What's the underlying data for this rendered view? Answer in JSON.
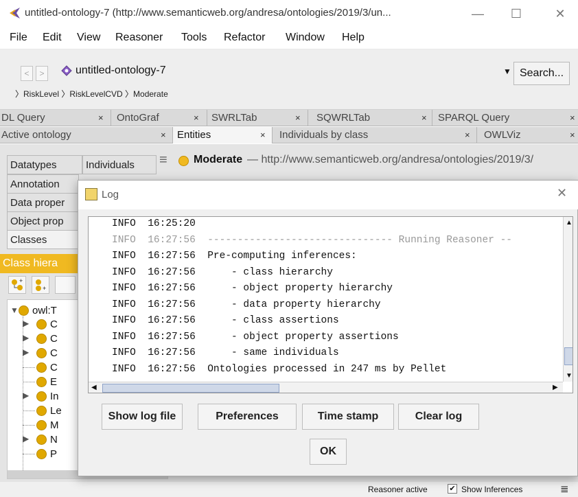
{
  "window": {
    "title": "untitled-ontology-7 (http://www.semanticweb.org/andresa/ontologies/2019/3/un...",
    "minimize": "—",
    "maximize": "☐",
    "close": "✕"
  },
  "menubar": [
    "File",
    "Edit",
    "View",
    "Reasoner",
    "Tools",
    "Refactor",
    "Window",
    "Help"
  ],
  "address": {
    "back": "<",
    "forward": ">",
    "ontology": "untitled-ontology-7",
    "search_label": "Search...",
    "breadcrumb": "〉RiskLevel 〉RiskLevelCVD 〉Moderate"
  },
  "tabs_row1": [
    {
      "label": "DL Query",
      "close": "×"
    },
    {
      "label": "OntoGraf",
      "close": "×"
    },
    {
      "label": "SWRLTab",
      "close": "×"
    },
    {
      "label": "SQWRLTab",
      "close": "×"
    },
    {
      "label": "SPARQL Query",
      "close": "×"
    }
  ],
  "tabs_row2": [
    {
      "label": "Active ontology",
      "close": "×"
    },
    {
      "label": "Entities",
      "close": "×"
    },
    {
      "label": "Individuals by class",
      "close": "×"
    },
    {
      "label": "OWLViz",
      "close": "×"
    }
  ],
  "left_tabs": {
    "datatypes": "Datatypes",
    "individuals": "Individuals",
    "annotation": "Annotation",
    "data_prop": "Data proper",
    "object_prop": "Object prop",
    "classes": "Classes",
    "class_hierarchy": "Class hiera"
  },
  "entity": {
    "menu_icon": "≡",
    "name": "Moderate",
    "iri": "— http://www.semanticweb.org/andresa/ontologies/2019/3/"
  },
  "tree": {
    "root": "owl:T",
    "items": [
      "C",
      "C",
      "C",
      "C",
      "E",
      "In",
      "Le",
      "M",
      "N",
      "P"
    ]
  },
  "log": {
    "title": "Log",
    "close": "✕",
    "lines": [
      {
        "level": "INFO",
        "time": "16:25:20",
        "msg": "",
        "grey": false
      },
      {
        "level": "INFO",
        "time": "16:27:56",
        "msg": "------------------------------- Running Reasoner --",
        "grey": true
      },
      {
        "level": "INFO",
        "time": "16:27:56",
        "msg": "Pre-computing inferences:",
        "grey": false
      },
      {
        "level": "INFO",
        "time": "16:27:56",
        "msg": "    - class hierarchy",
        "grey": false
      },
      {
        "level": "INFO",
        "time": "16:27:56",
        "msg": "    - object property hierarchy",
        "grey": false
      },
      {
        "level": "INFO",
        "time": "16:27:56",
        "msg": "    - data property hierarchy",
        "grey": false
      },
      {
        "level": "INFO",
        "time": "16:27:56",
        "msg": "    - class assertions",
        "grey": false
      },
      {
        "level": "INFO",
        "time": "16:27:56",
        "msg": "    - object property assertions",
        "grey": false
      },
      {
        "level": "INFO",
        "time": "16:27:56",
        "msg": "    - same individuals",
        "grey": false
      },
      {
        "level": "INFO",
        "time": "16:27:56",
        "msg": "Ontologies processed in 247 ms by Pellet",
        "grey": false
      }
    ],
    "buttons": {
      "show_log": "Show log file",
      "preferences": "Preferences",
      "timestamp": "Time stamp",
      "clear": "Clear log",
      "ok": "OK"
    }
  },
  "status": {
    "reasoner": "Reasoner active",
    "checkbox": "✔",
    "show_inferences": "Show Inferences",
    "menu_icon": "≣"
  },
  "colors": {
    "accent": "#f0b921",
    "node": "#e0a800",
    "tab_bg": "#dadada"
  }
}
